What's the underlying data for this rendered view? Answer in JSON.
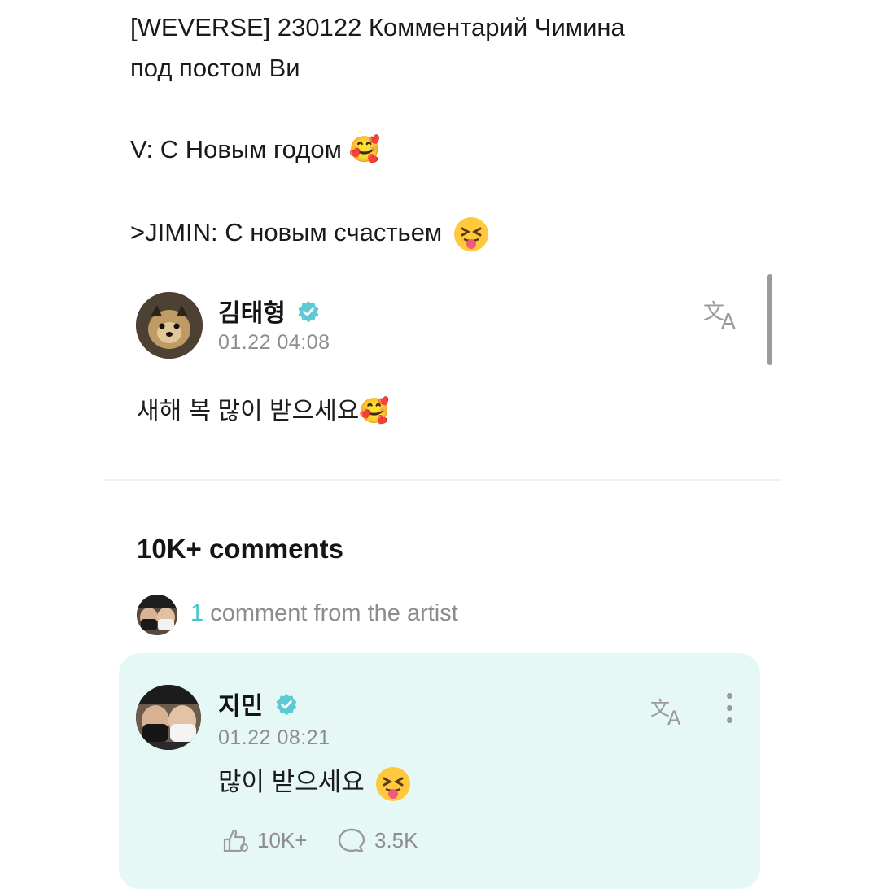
{
  "caption": {
    "title_line1": "[WEVERSE] 230122 Комментарий Чимина",
    "title_line2": "под постом Ви",
    "v_line": "V: С Новым годом 🥰",
    "jimin_line": ">JIMIN: С новым счастьем"
  },
  "post": {
    "author": "김태형",
    "verified": true,
    "timestamp": "01.22 04:08",
    "body": "새해 복 많이 받으세요🥰",
    "translate_icon": "translate-icon"
  },
  "comments_section": {
    "heading": "10K+ comments",
    "artist_count": "1",
    "artist_text": " comment from the artist"
  },
  "comment": {
    "author": "지민",
    "verified": true,
    "timestamp": "01.22 08:21",
    "text": "많이 받으세요",
    "likes": "10K+",
    "replies": "3.5K"
  },
  "colors": {
    "accent": "#43c6c8",
    "comment_card_bg": "#e6f8f6",
    "verified_badge": "#5cc9d4"
  }
}
